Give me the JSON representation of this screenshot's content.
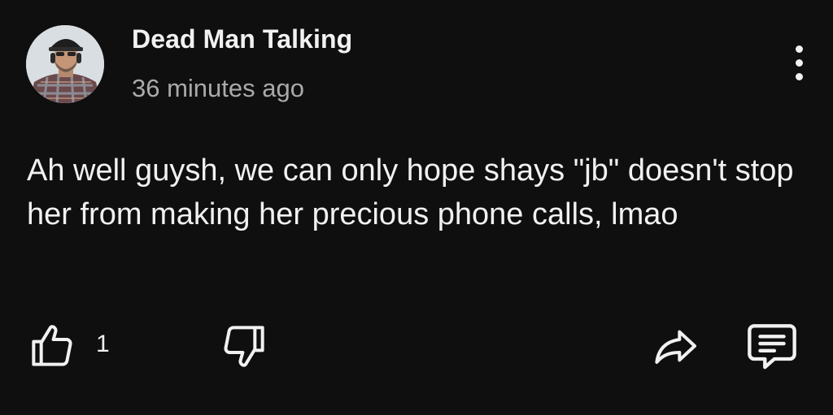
{
  "comment": {
    "author": "Dead Man Talking",
    "timestamp": "36 minutes ago",
    "text": "Ah well guysh, we can only hope shays \"jb\" doesn't stop her from making her precious phone calls, lmao",
    "like_count": "1"
  },
  "icons": {
    "more": "more-vertical-icon",
    "like": "thumb-up-icon",
    "dislike": "thumb-down-icon",
    "share": "share-icon",
    "reply": "comment-icon"
  },
  "colors": {
    "background": "#0f0f0f",
    "primary_text": "#f1f1f1",
    "secondary_text": "#aaaaaa"
  }
}
